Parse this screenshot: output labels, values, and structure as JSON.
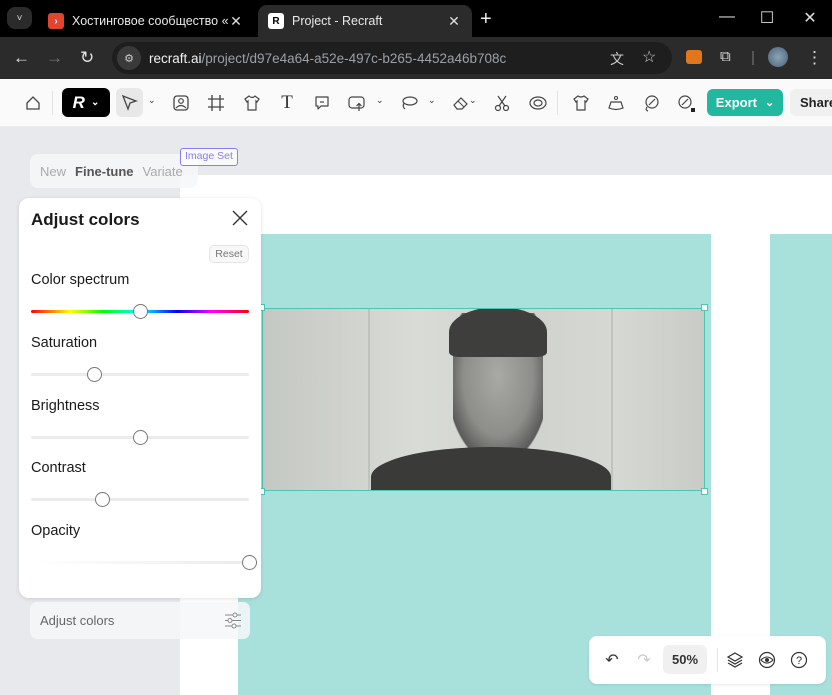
{
  "browser": {
    "tabs": [
      {
        "title": "Хостинговое сообщество «Tim",
        "favicon": "timeweb-favicon",
        "active": false
      },
      {
        "title": "Project - Recraft",
        "favicon": "recraft-favicon",
        "active": true
      }
    ],
    "url_domain": "recraft.ai",
    "url_path": "/project/d97e4a64-a52e-497c-b265-4452a46b708c",
    "icons": {
      "tab_list": "˅",
      "close": "✕",
      "new_tab": "+",
      "minimize": "—",
      "maximize": "☐",
      "window_close": "✕",
      "back": "←",
      "forward": "→",
      "reload": "↻",
      "site_info": "⚙",
      "translate": "文",
      "bookmark": "☆",
      "extensions": "⧉",
      "menu": "⋮"
    }
  },
  "toolbar": {
    "logo": "R",
    "export_label": "Export",
    "share_label": "Share",
    "caret": "⌄"
  },
  "canvas": {
    "image_set_tag": "Image Set",
    "mode_tabs": [
      "New",
      "Fine-tune",
      "Variate"
    ],
    "active_mode": "Fine-tune",
    "accent_color": "#22b8a0",
    "frame_color": "#a8e1dc"
  },
  "adjust_panel": {
    "title": "Adjust colors",
    "reset_label": "Reset",
    "controls": [
      {
        "label": "Color spectrum",
        "value_fraction": 0.5
      },
      {
        "label": "Saturation",
        "value_fraction": 0.29
      },
      {
        "label": "Brightness",
        "value_fraction": 0.5
      },
      {
        "label": "Contrast",
        "value_fraction": 0.33
      },
      {
        "label": "Opacity",
        "value_fraction": 1.0
      }
    ]
  },
  "adjust_row": {
    "label": "Adjust colors"
  },
  "bottom_bar": {
    "zoom": "50%",
    "undo": "↶",
    "redo": "↷",
    "help": "?"
  }
}
